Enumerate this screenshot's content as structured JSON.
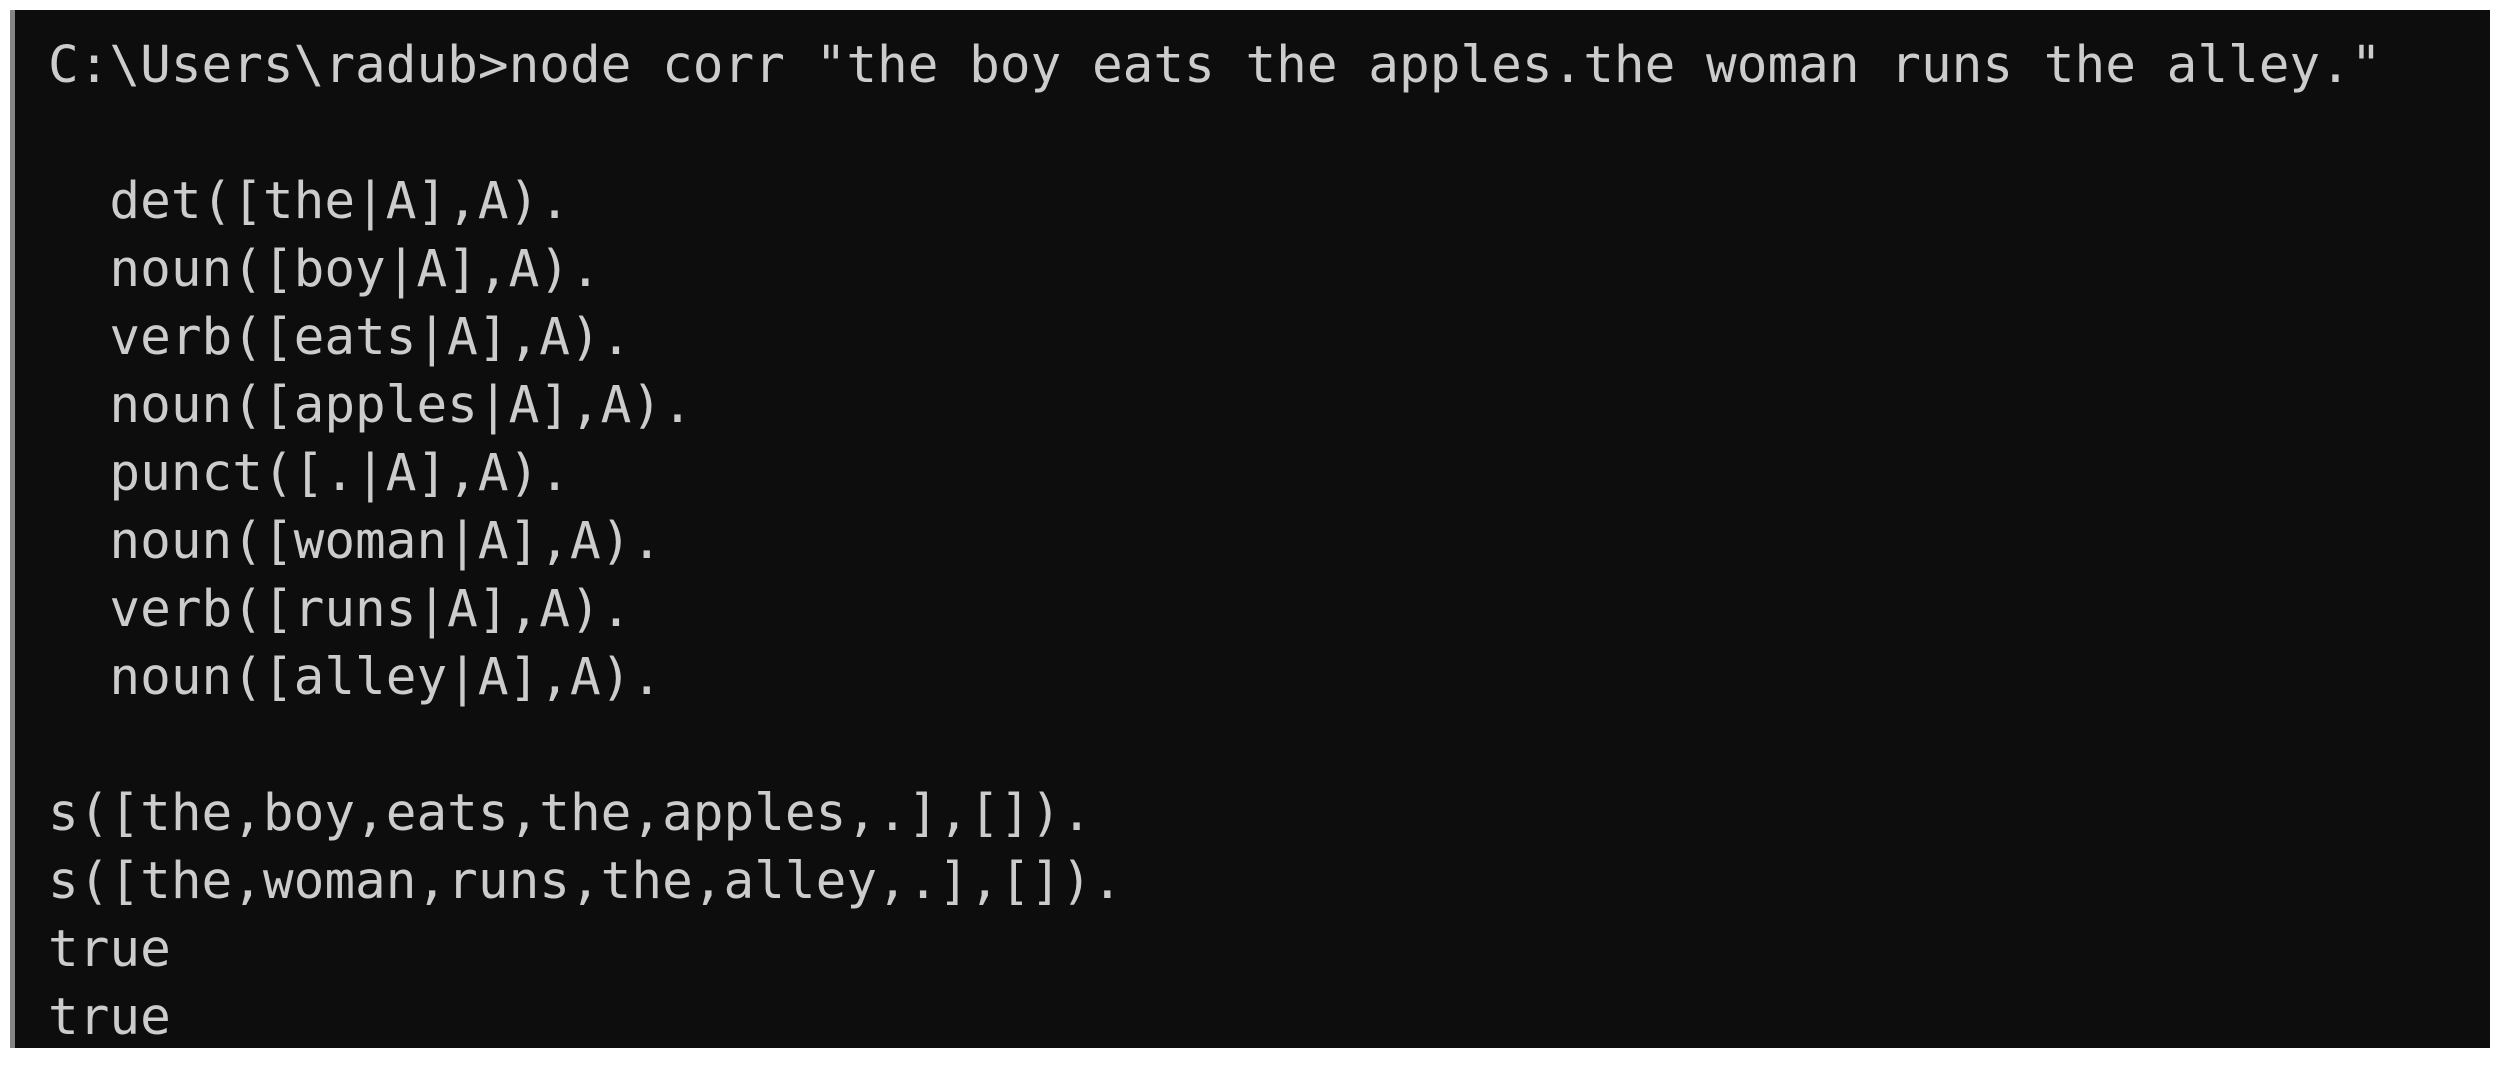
{
  "window": {
    "kind": "windows-command-prompt",
    "background_color": "#0d0d0d",
    "text_color": "#cccccc",
    "border_color": "#858585",
    "page_color": "#ffffff"
  },
  "console": {
    "prompt_path": "C:\\Users\\radub",
    "prompt_symbol": ">",
    "command": "node corr \"the boy eats the apples.the woman runs the alley.\"",
    "lines": [
      "C:\\Users\\radub>node corr \"the boy eats the apples.the woman runs the alley.\"",
      "",
      "  det([the|A],A).",
      "  noun([boy|A],A).",
      "  verb([eats|A],A).",
      "  noun([apples|A],A).",
      "  punct([.|A],A).",
      "  noun([woman|A],A).",
      "  verb([runs|A],A).",
      "  noun([alley|A],A).",
      "",
      "s([the,boy,eats,the,apples,.],[]).",
      "s([the,woman,runs,the,alley,.],[]).",
      "true",
      "true"
    ]
  }
}
